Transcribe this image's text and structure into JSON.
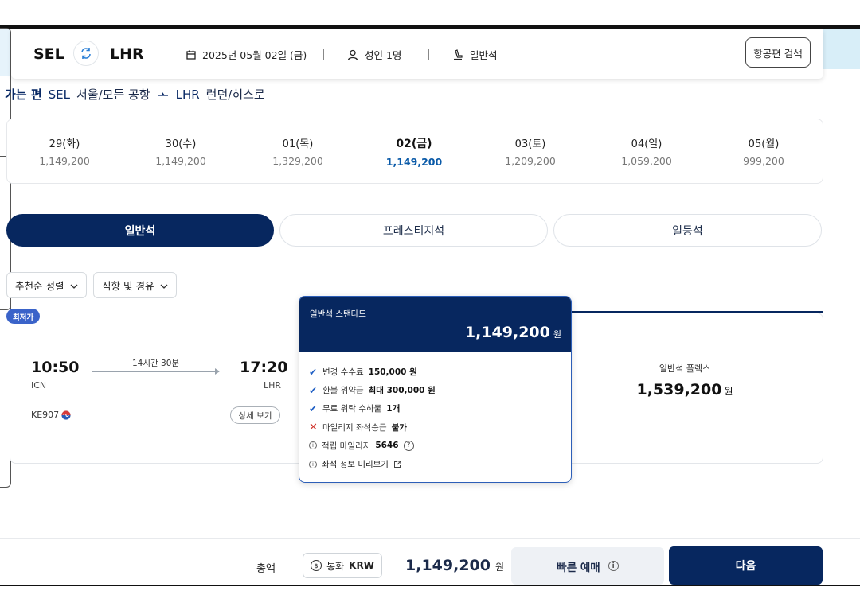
{
  "header": {
    "origin": "SEL",
    "destination": "LHR",
    "date": "2025년 05월 02일 (금)",
    "passengers": "성인 1명",
    "cabin": "일반석",
    "search_button": "항공편 검색"
  },
  "route": {
    "direction_label": "가는 편",
    "origin_code": "SEL",
    "origin_name": "서울/모든 공항",
    "destination_code": "LHR",
    "destination_name": "런던/히스로"
  },
  "dates": [
    {
      "day": "29(화)",
      "price": "1,149,200"
    },
    {
      "day": "30(수)",
      "price": "1,149,200"
    },
    {
      "day": "01(목)",
      "price": "1,329,200"
    },
    {
      "day": "02(금)",
      "price": "1,149,200",
      "active": true
    },
    {
      "day": "03(토)",
      "price": "1,209,200"
    },
    {
      "day": "04(일)",
      "price": "1,059,200"
    },
    {
      "day": "05(월)",
      "price": "999,200"
    }
  ],
  "cabin_tabs": [
    "일반석",
    "프레스티지석",
    "일등석"
  ],
  "filters": [
    "추천순 정렬",
    "직항 및 경유"
  ],
  "flight": {
    "badge": "최저가",
    "depart_time": "10:50",
    "depart_airport": "ICN",
    "arrive_time": "17:20",
    "arrive_airport": "LHR",
    "duration": "14시간 30분",
    "flight_number": "KE907",
    "detail_button": "상세 보기",
    "flex_fare_name": "일반석 플렉스",
    "flex_fare_price": "1,539,200",
    "currency_unit": "원"
  },
  "popover": {
    "title": "일반석 스탠다드",
    "price": "1,149,200",
    "unit": "원",
    "rows": [
      {
        "text": "변경 수수료",
        "bold": "150,000 원"
      },
      {
        "text": "환불 위약금",
        "bold": "최대 300,000 원"
      },
      {
        "text": "무료 위탁 수하물",
        "bold": "1개"
      },
      {
        "text": "마일리지 좌석승급",
        "bold": "불가"
      },
      {
        "text": "적립 마일리지",
        "bold": "5646"
      },
      {
        "text": "좌석 정보 미리보기",
        "bold": ""
      }
    ]
  },
  "footer": {
    "total_label": "총액",
    "currency_label": "통화",
    "currency_code": "KRW",
    "total_price": "1,149,200",
    "unit": "원",
    "quick_booking": "빠른 예매",
    "next": "다음"
  },
  "colors": {
    "navy": "#07275f",
    "accent_blue": "#0a5aa8",
    "error_red": "#d0342c"
  }
}
